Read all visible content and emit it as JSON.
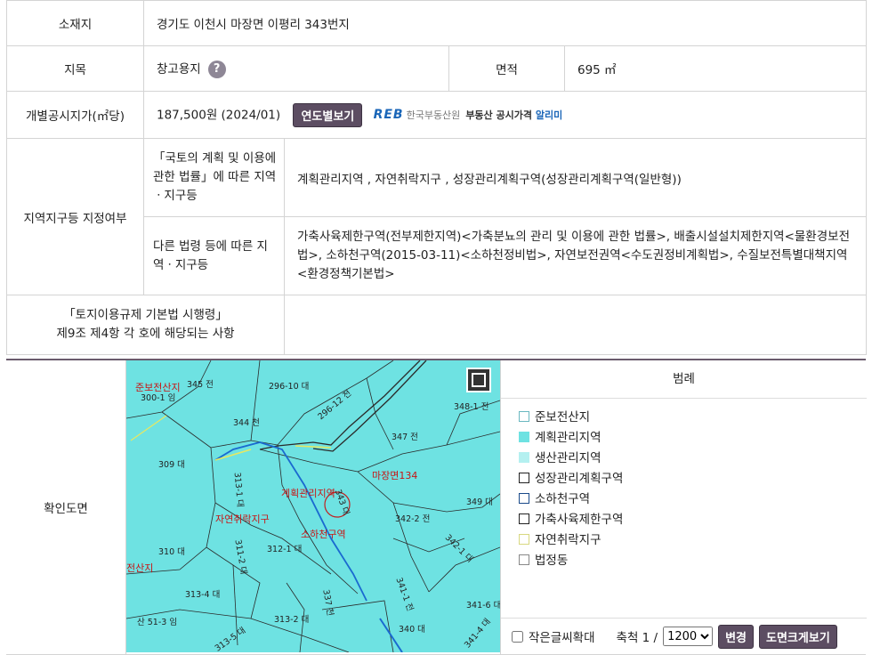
{
  "rows": {
    "location": {
      "label": "소재지",
      "value": "경기도 이천시 마장면 이평리 343번지"
    },
    "land_category": {
      "label": "지목",
      "value": "창고용지",
      "help": "?"
    },
    "area": {
      "label": "면적",
      "value": "695 ㎡"
    },
    "land_price": {
      "label": "개별공시지가(㎡당)",
      "value": "187,500원 (2024/01)",
      "button": "연도별보기"
    },
    "reb": {
      "logo": "REB",
      "org": "한국부동산원",
      "alert_prefix": "부동산 공시가격",
      "alert_suffix": "알리미"
    },
    "zoning": {
      "label": "지역지구등 지정여부",
      "national_label": "「국토의 계획 및 이용에 관한 법률」에 따른 지역ㆍ지구등",
      "national_value": "계획관리지역 , 자연취락지구 , 성장관리계획구역(성장관리계획구역(일반형))",
      "other_label": "다른 법령 등에 따른 지역ㆍ지구등",
      "other_value": "가축사육제한구역(전부제한지역)<가축분뇨의 관리 및 이용에 관한 법률>, 배출시설설치제한지역<물환경보전법>, 소하천구역(2015-03-11)<소하천정비법>, 자연보전권역<수도권정비계획법>, 수질보전특별대책지역<환경정책기본법>"
    },
    "enforcement": {
      "label_line1": "「토지이용규제 기본법 시행령」",
      "label_line2": "제9조 제4항 각 호에 해당되는 사항",
      "value": ""
    }
  },
  "map": {
    "label": "확인도면",
    "parcels": [
      "345 전",
      "300-1 임",
      "296-10 대",
      "296-12 전",
      "344 천",
      "348-1 전",
      "347 전",
      "309 대",
      "349 대",
      "342-2 전",
      "342-1 대",
      "310 대",
      "312-1 대",
      "313-4 대",
      "341-1 전",
      "341-6 대",
      "313-2 대",
      "산 51-3 임",
      "340 대",
      "313-5 대",
      "341-4 대",
      "311-2 대",
      "343 대",
      "313-1 대",
      "337 천"
    ],
    "zone_labels": [
      "준보전산지",
      "계획관리지역",
      "자연취락지구",
      "소하천구역",
      "마장면134",
      "전산지"
    ]
  },
  "legend": {
    "title": "범례",
    "items": [
      {
        "label": "준보전산지",
        "color": "#ffffff",
        "border": "#6ab8c0"
      },
      {
        "label": "계획관리지역",
        "color": "#6ee2e2",
        "border": "#6ee2e2"
      },
      {
        "label": "생산관리지역",
        "color": "#b4f0f0",
        "border": "#b4f0f0"
      },
      {
        "label": "성장관리계획구역",
        "color": "#ffffff",
        "border": "#222222"
      },
      {
        "label": "소하천구역",
        "color": "#ffffff",
        "border": "#1a4a8a"
      },
      {
        "label": "가축사육제한구역",
        "color": "#ffffff",
        "border": "#222222"
      },
      {
        "label": "자연취락지구",
        "color": "#ffffff",
        "border": "#d8d880"
      },
      {
        "label": "법정동",
        "color": "#ffffff",
        "border": "#888888"
      }
    ],
    "zoom_label": "작은글씨확대",
    "scale_label": "축척 1 /",
    "scale_value": "1200",
    "change_button": "변경",
    "large_map_button": "도면크게보기"
  }
}
